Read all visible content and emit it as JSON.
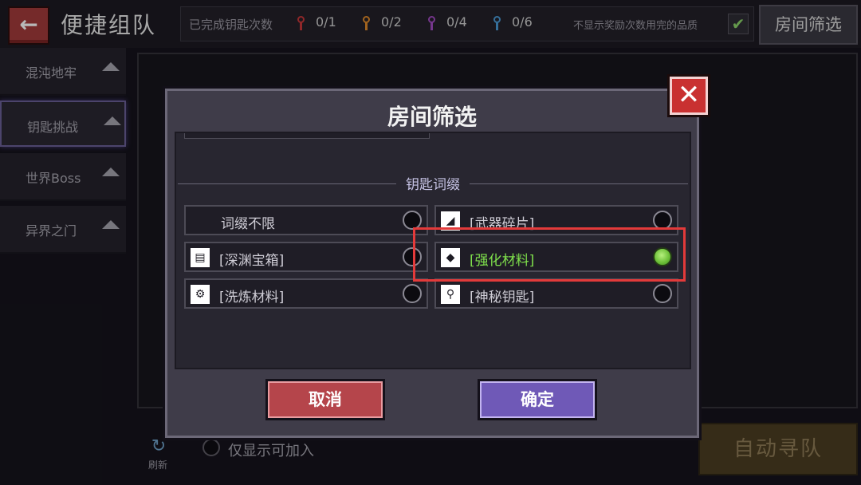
{
  "header": {
    "back_icon": "arrow-left-icon",
    "title": "便捷组队",
    "keys_label": "已完成钥匙次数",
    "keys": [
      {
        "icon": "key-icon",
        "color": "#c8373a",
        "count": "0/1"
      },
      {
        "icon": "key-icon",
        "color": "#e08a2a",
        "count": "0/2"
      },
      {
        "icon": "key-icon",
        "color": "#a34bc2",
        "count": "0/4"
      },
      {
        "icon": "key-icon",
        "color": "#4a9ad6",
        "count": "0/6"
      }
    ],
    "hide_label": "不显示奖励次数用完的品质",
    "hide_checked": true,
    "filter_button": "房间筛选"
  },
  "sidebar": {
    "items": [
      {
        "label": "混沌地牢",
        "active": false
      },
      {
        "label": "钥匙挑战",
        "active": true
      },
      {
        "label": "世界Boss",
        "active": false
      },
      {
        "label": "异界之门",
        "active": false
      }
    ]
  },
  "footer": {
    "refresh_label": "刷新",
    "only_joinable_label": "仅显示可加入",
    "auto_button": "自动寻队"
  },
  "dialog": {
    "title": "房间筛选",
    "section_label": "钥匙词缀",
    "options": [
      {
        "label": "词缀不限",
        "icon": "",
        "selected": false
      },
      {
        "label": "[武器碎片]",
        "icon": "weapon-fragment-icon",
        "selected": false
      },
      {
        "label": "[深渊宝箱]",
        "icon": "chest-icon",
        "selected": false
      },
      {
        "label": "[强化材料]",
        "icon": "enhance-material-icon",
        "selected": true
      },
      {
        "label": "[洗炼材料]",
        "icon": "refine-material-icon",
        "selected": false
      },
      {
        "label": "[神秘钥匙]",
        "icon": "mystery-key-icon",
        "selected": false
      }
    ],
    "cancel_button": "取消",
    "confirm_button": "确定"
  },
  "colors": {
    "highlight": "#e33a3a",
    "selected_text": "#7fe04c",
    "cancel": "#b5454b",
    "confirm": "#6f59b7"
  }
}
